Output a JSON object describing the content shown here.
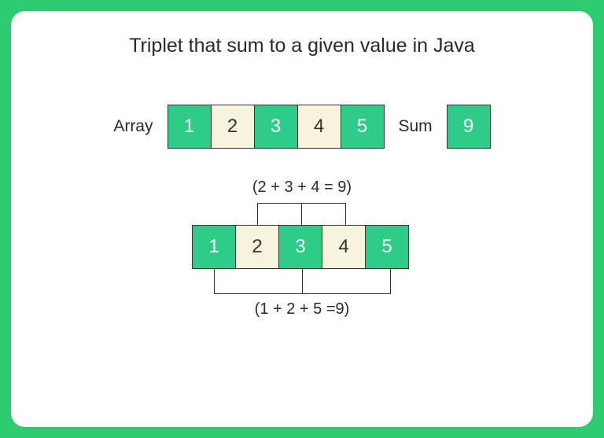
{
  "title": "Triplet that sum to a given value in Java",
  "labels": {
    "array": "Array",
    "sum": "Sum"
  },
  "array": [
    "1",
    "2",
    "3",
    "4",
    "5"
  ],
  "sum_value": "9",
  "expr_top": "(2 + 3 + 4 = 9)",
  "expr_bottom": "(1 + 2 + 5 =9)",
  "array2": [
    "1",
    "2",
    "3",
    "4",
    "5"
  ]
}
